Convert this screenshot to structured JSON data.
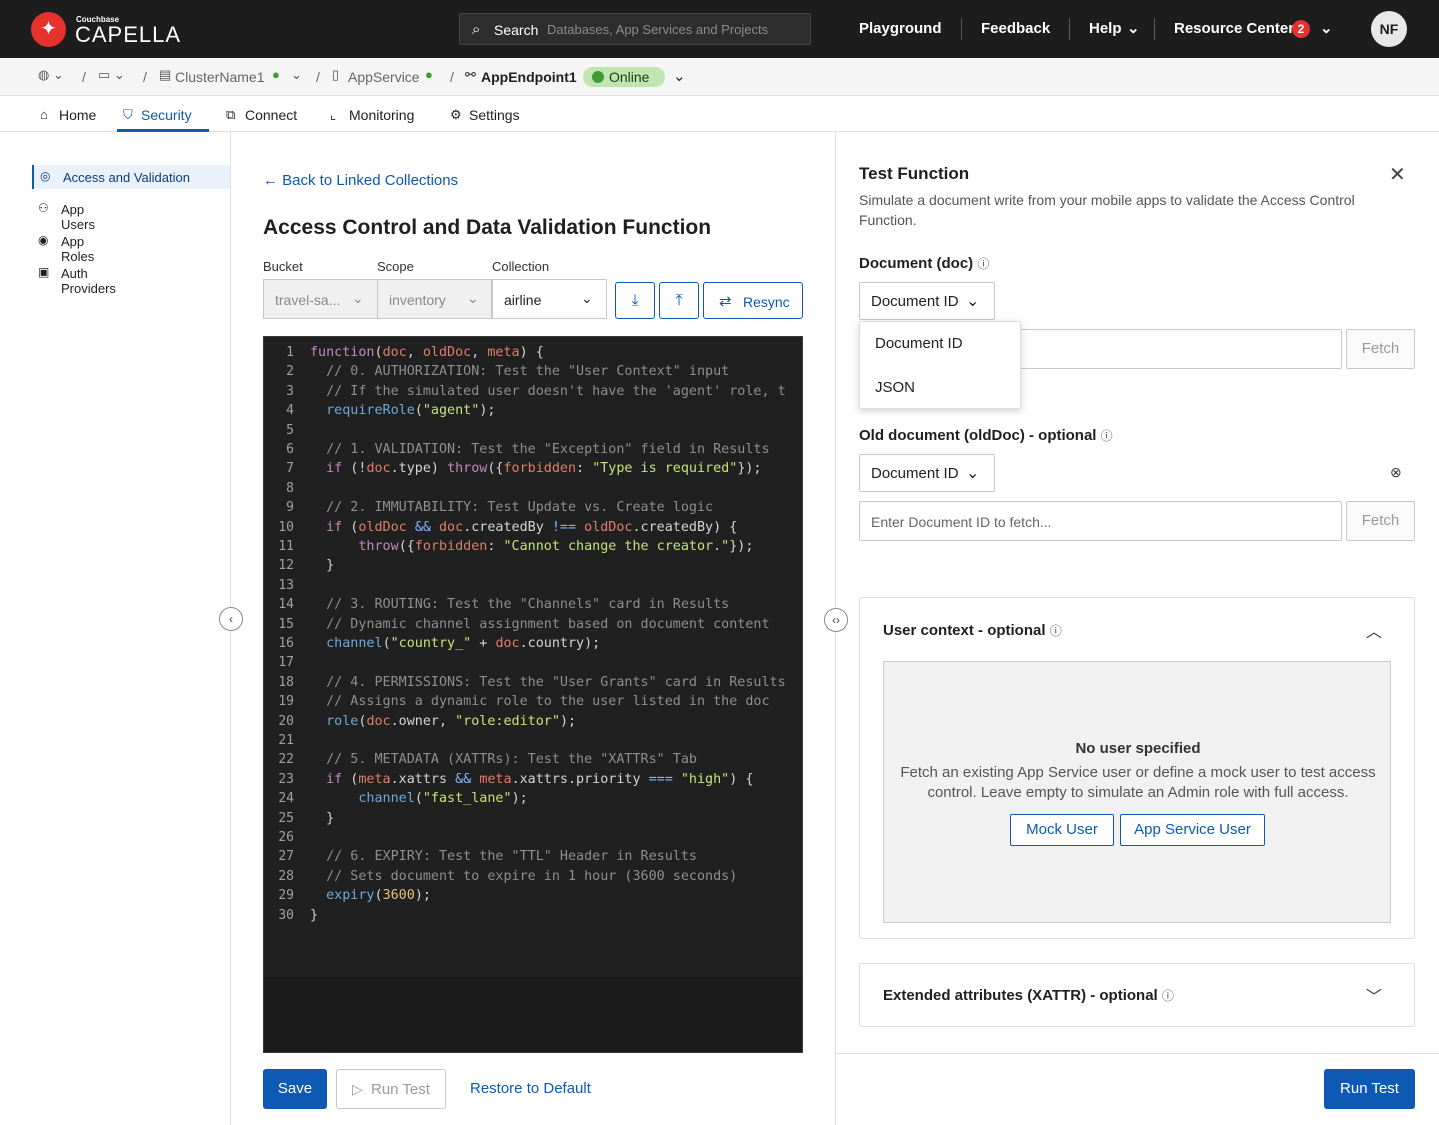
{
  "app": {
    "brand_small": "Couchbase",
    "brand_big": "CAPELLA",
    "logo_glyph": "✦",
    "search_label": "Search",
    "search_placeholder": "Databases, App Services and Projects",
    "nav": {
      "playground": "Playground",
      "feedback": "Feedback",
      "help": "Help",
      "resource_center": "Resource Center",
      "resource_badge": "2"
    },
    "avatar": "NF"
  },
  "breadcrumb": {
    "cluster": "ClusterName1",
    "app_service": "AppService",
    "endpoint": "AppEndpoint1",
    "status": "Online",
    "sep": "/"
  },
  "tabs": {
    "home": "Home",
    "security": "Security",
    "connect": "Connect",
    "monitoring": "Monitoring",
    "settings": "Settings"
  },
  "sidebar": {
    "items": [
      {
        "label": "Access and Validation",
        "icon": "check-circle-icon"
      },
      {
        "label": "App Users",
        "icon": "users-icon"
      },
      {
        "label": "App Roles",
        "icon": "user-circle-icon"
      },
      {
        "label": "Auth Providers",
        "icon": "badge-icon"
      }
    ]
  },
  "main": {
    "back_link": "Back to Linked Collections",
    "title": "Access Control and Data Validation Function",
    "bucket_label": "Bucket",
    "bucket_value": "travel-sa...",
    "scope_label": "Scope",
    "scope_value": "inventory",
    "collection_label": "Collection",
    "collection_value": "airline",
    "resync_label": "Resync",
    "save_label": "Save",
    "run_test_label": "Run Test",
    "restore_label": "Restore to Default"
  },
  "code_lines": [
    "function(doc, oldDoc, meta) {",
    "  // 0. AUTHORIZATION: Test the \"User Context\" input",
    "  // If the simulated user doesn't have the 'agent' role, t",
    "  requireRole(\"agent\");",
    "",
    "  // 1. VALIDATION: Test the \"Exception\" field in Results",
    "  if (!doc.type) throw({forbidden: \"Type is required\"});",
    "",
    "  // 2. IMMUTABILITY: Test Update vs. Create logic",
    "  if (oldDoc && doc.createdBy !== oldDoc.createdBy) {",
    "      throw({forbidden: \"Cannot change the creator.\"});",
    "  }",
    "",
    "  // 3. ROUTING: Test the \"Channels\" card in Results",
    "  // Dynamic channel assignment based on document content",
    "  channel(\"country_\" + doc.country);",
    "",
    "  // 4. PERMISSIONS: Test the \"User Grants\" card in Results",
    "  // Assigns a dynamic role to the user listed in the doc",
    "  role(doc.owner, \"role:editor\");",
    "",
    "  // 5. METADATA (XATTRs): Test the \"XATTRs\" Tab",
    "  if (meta.xattrs && meta.xattrs.priority === \"high\") {",
    "      channel(\"fast_lane\");",
    "  }",
    "",
    "  // 6. EXPIRY: Test the \"TTL\" Header in Results",
    "  // Sets document to expire in 1 hour (3600 seconds)",
    "  expiry(3600);",
    "}"
  ],
  "test_panel": {
    "title": "Test Function",
    "description": "Simulate a document write from your mobile apps to validate the Access Control Function.",
    "doc_label": "Document (doc)",
    "doc_type_selected": "Document ID",
    "doc_type_options": [
      "Document ID",
      "JSON"
    ],
    "fetch_label": "Fetch",
    "old_doc_label": "Old document (oldDoc) - optional",
    "old_doc_type_selected": "Document ID",
    "old_doc_placeholder": "Enter Document ID to fetch...",
    "user_context_label": "User context - optional",
    "no_user_title": "No user specified",
    "no_user_desc": "Fetch an existing App Service user or define a mock user to test access control. Leave empty to simulate an Admin role with full access.",
    "mock_user_label": "Mock User",
    "app_service_user_label": "App Service User",
    "xattr_label": "Extended attributes (XATTR) - optional",
    "run_test_label": "Run Test"
  },
  "colors": {
    "accent": "#0d59b3",
    "online_bg": "#bfe5b0",
    "brand_red": "#e5322d",
    "topbar": "#1d1d1d"
  }
}
